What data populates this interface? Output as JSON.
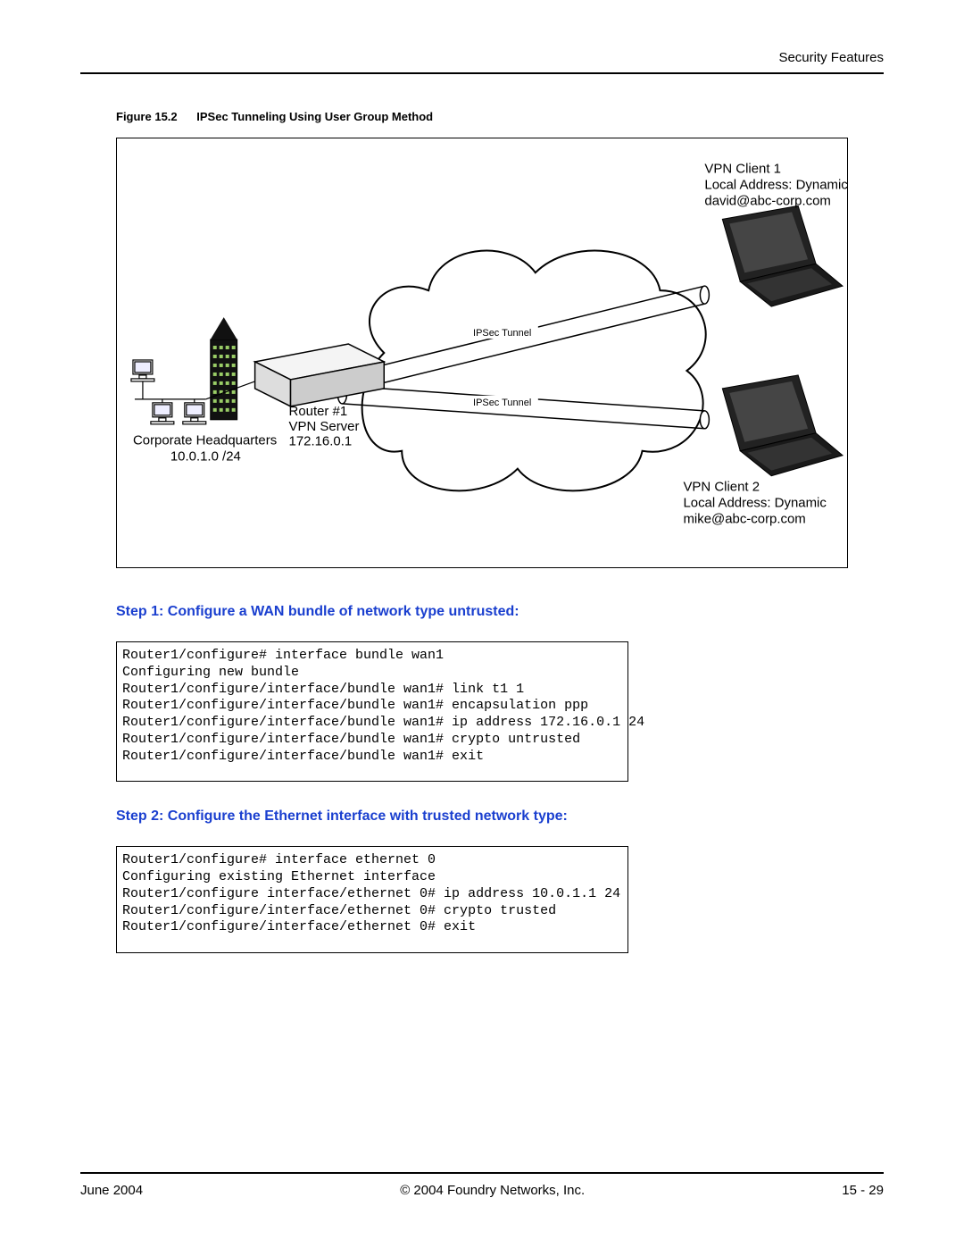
{
  "header": {
    "section": "Security Features"
  },
  "figure": {
    "number": "Figure 15.2",
    "title": "IPSec Tunneling Using User Group Method"
  },
  "diagram": {
    "client1": {
      "line1": "VPN Client 1",
      "line2": "Local Address: Dynamic",
      "line3": "david@abc-corp.com"
    },
    "client2": {
      "line1": "VPN Client 2",
      "line2": "Local Address: Dynamic",
      "line3": "mike@abc-corp.com"
    },
    "router": {
      "line1": "Router #1",
      "line2": "VPN Server",
      "line3": "172.16.0.1"
    },
    "hq": {
      "line1": "Corporate Headquarters",
      "line2": "10.0.1.0 /24"
    },
    "tunnel_label": "IPSec Tunnel"
  },
  "step1": {
    "heading": "Step 1: Configure a WAN bundle of network type untrusted:",
    "code": "Router1/configure# interface bundle wan1\nConfiguring new bundle\nRouter1/configure/interface/bundle wan1# link t1 1\nRouter1/configure/interface/bundle wan1# encapsulation ppp\nRouter1/configure/interface/bundle wan1# ip address 172.16.0.1 24\nRouter1/configure/interface/bundle wan1# crypto untrusted\nRouter1/configure/interface/bundle wan1# exit"
  },
  "step2": {
    "heading": "Step 2: Configure the Ethernet interface with trusted network type:",
    "code": "Router1/configure# interface ethernet 0\nConfiguring existing Ethernet interface\nRouter1/configure interface/ethernet 0# ip address 10.0.1.1 24\nRouter1/configure/interface/ethernet 0# crypto trusted\nRouter1/configure/interface/ethernet 0# exit"
  },
  "footer": {
    "left": "June 2004",
    "center": "© 2004 Foundry Networks, Inc.",
    "right": "15 - 29"
  }
}
